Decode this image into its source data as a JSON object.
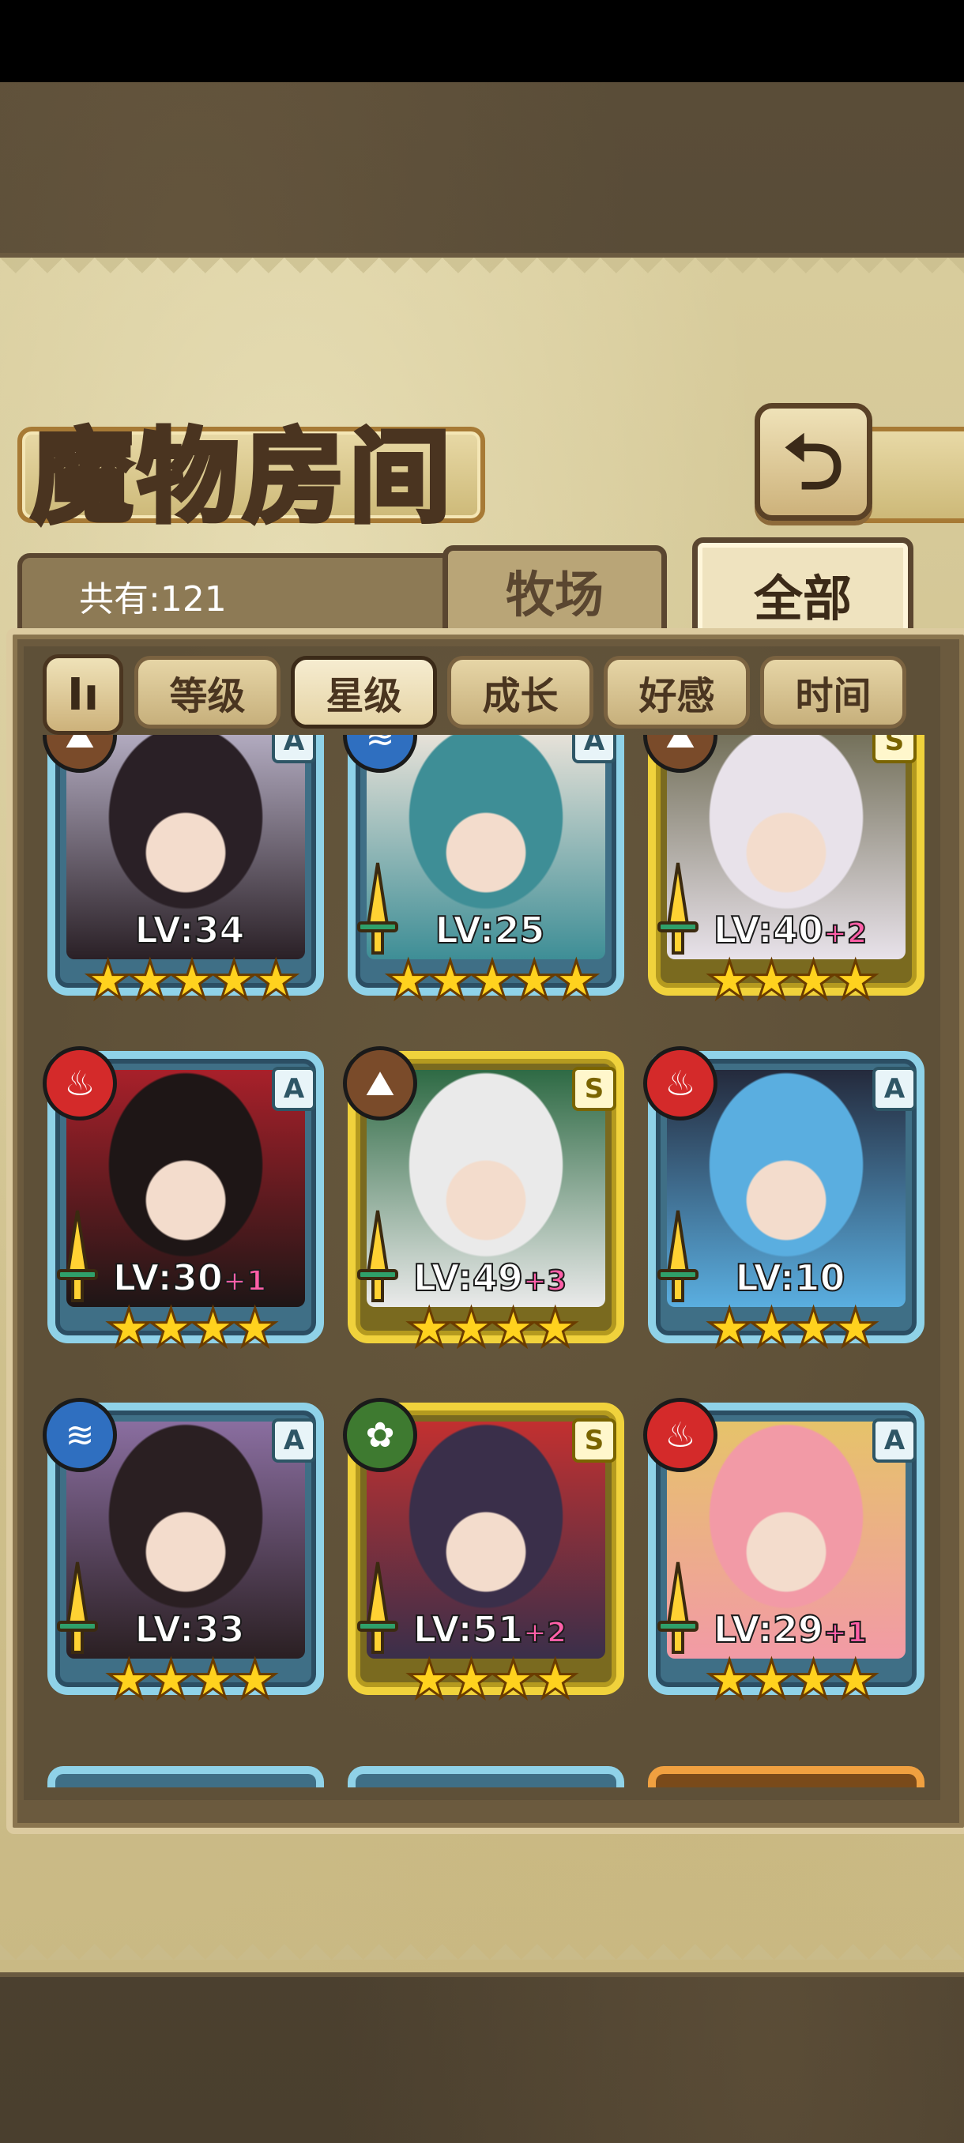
{
  "title": "魔物房间",
  "back_icon": "back-arrow-icon",
  "count_label": "共有:121",
  "tabs": [
    {
      "label": "牧场",
      "selected": false
    },
    {
      "label": "全部",
      "selected": true
    }
  ],
  "sort_toggle_glyph": "Iı",
  "sort_options": [
    {
      "label": "等级",
      "active": false
    },
    {
      "label": "星级",
      "active": true
    },
    {
      "label": "成长",
      "active": false
    },
    {
      "label": "好感",
      "active": false
    },
    {
      "label": "时间",
      "active": false
    }
  ],
  "cards": [
    {
      "element": "earth",
      "element_glyph": "⛰",
      "rank": "A",
      "level": "LV:34",
      "plus": "",
      "stars": "★★★★★",
      "sword": false,
      "colors": [
        "#2a2026",
        "#b9b2c8"
      ]
    },
    {
      "element": "water",
      "element_glyph": "≋",
      "rank": "A",
      "level": "LV:25",
      "plus": "",
      "stars": "★★★★★",
      "sword": true,
      "colors": [
        "#3e8e96",
        "#f0e6dc"
      ]
    },
    {
      "element": "earth",
      "element_glyph": "⛰",
      "rank": "S",
      "level": "LV:40",
      "plus": "+2",
      "stars": "★★★★",
      "sword": true,
      "colors": [
        "#e8e2ea",
        "#6d6a52"
      ]
    },
    {
      "element": "fire",
      "element_glyph": "♨",
      "rank": "A",
      "level": "LV:30",
      "plus": "+1",
      "stars": "★★★★",
      "sword": true,
      "colors": [
        "#1e1616",
        "#a8202a"
      ]
    },
    {
      "element": "earth",
      "element_glyph": "⛰",
      "rank": "S",
      "level": "LV:49",
      "plus": "+3",
      "stars": "★★★★",
      "sword": true,
      "colors": [
        "#eaeaea",
        "#2e6a44"
      ]
    },
    {
      "element": "fire",
      "element_glyph": "♨",
      "rank": "A",
      "level": "LV:10",
      "plus": "",
      "stars": "★★★★",
      "sword": true,
      "colors": [
        "#5aaee0",
        "#242a3c"
      ]
    },
    {
      "element": "water",
      "element_glyph": "≋",
      "rank": "A",
      "level": "LV:33",
      "plus": "",
      "stars": "★★★★",
      "sword": true,
      "colors": [
        "#2a1f22",
        "#8a6ea0"
      ]
    },
    {
      "element": "wood",
      "element_glyph": "✿",
      "rank": "S",
      "level": "LV:51",
      "plus": "+2",
      "stars": "★★★★",
      "sword": true,
      "colors": [
        "#3a2f4a",
        "#c23030"
      ]
    },
    {
      "element": "fire",
      "element_glyph": "♨",
      "rank": "A",
      "level": "LV:29",
      "plus": "+1",
      "stars": "★★★★",
      "sword": true,
      "colors": [
        "#f29aa6",
        "#e6c36a"
      ]
    }
  ]
}
